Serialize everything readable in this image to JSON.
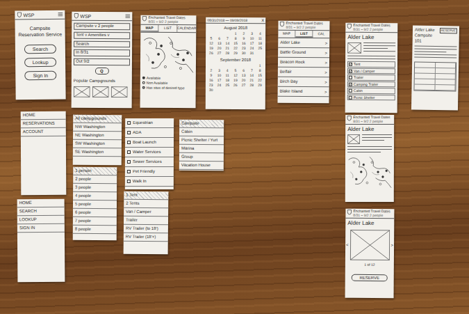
{
  "cards": [
    {
      "kind": "home",
      "header": "WSP",
      "lines": [
        "Campsite",
        "Reservation Service"
      ],
      "buttons": [
        "Search",
        "Lookup",
        "Sign In"
      ]
    },
    {
      "kind": "search",
      "header": "WSP",
      "fields": [
        "Campsite v  2 people",
        "Tent v  Amenities v",
        "Search",
        "In 8/31",
        "Out 9/2"
      ],
      "button": "Q",
      "section": "Popular Campgrounds"
    },
    {
      "kind": "map",
      "banner": {
        "title": "Enchanted Travel Dates",
        "sub": "8/31 – 9/2  2 people"
      },
      "tabs": [
        {
          "label": "MAP",
          "selected": true
        },
        {
          "label": "LIST",
          "selected": false
        },
        {
          "label": "CALENDAR",
          "selected": false
        }
      ],
      "legend": [
        "Available",
        "Non Available",
        "Has sites of desired type"
      ]
    },
    {
      "kind": "calendar",
      "range": "08/31/2018 — 09/09/2018",
      "close": "X",
      "months": [
        {
          "name": "August 2018",
          "days": [
            "1",
            "2",
            "3",
            "4",
            "5",
            "6",
            "7",
            "8",
            "9",
            "10",
            "11",
            "12",
            "13",
            "14",
            "15",
            "16",
            "17",
            "18",
            "19",
            "20",
            "21",
            "22",
            "23",
            "24",
            "25",
            "26",
            "27",
            "28",
            "29",
            "30",
            "31"
          ]
        },
        {
          "name": "September 2018",
          "days": [
            "1",
            "2",
            "3",
            "4",
            "5",
            "6",
            "7",
            "8",
            "9",
            "10",
            "11",
            "12",
            "13",
            "14",
            "15",
            "16",
            "17",
            "18",
            "19",
            "20",
            "21",
            "22",
            "23",
            "24",
            "25",
            "26",
            "27",
            "28",
            "29",
            "30"
          ]
        }
      ]
    },
    {
      "kind": "list",
      "banner": {
        "title": "Enchanted Travel Dates",
        "sub": "8/31 – 9/2  2 people"
      },
      "tabs": [
        {
          "label": "MAP",
          "selected": false
        },
        {
          "label": "LIST",
          "selected": true
        },
        {
          "label": "CAL",
          "selected": false
        }
      ],
      "arrow": ">",
      "items": [
        "Alder Lake",
        "Battle Ground",
        "Beacon Rock",
        "Belfair",
        "Birch Bay",
        "Blake Island"
      ]
    },
    {
      "kind": "detail",
      "banner": {
        "title": "Enchanted Travel Dates",
        "sub": "8/31 – 9/2  2 people"
      },
      "title": "Alder Lake",
      "options": [
        {
          "label": "Tent",
          "checked": true
        },
        {
          "label": "Van / Camper",
          "checked": true
        },
        {
          "label": "Trailer",
          "checked": false
        },
        {
          "label": "Camping Trailer",
          "checked": true
        },
        {
          "label": "Cabin",
          "checked": false
        },
        {
          "label": "Picnic Shelter",
          "checked": false
        }
      ]
    },
    {
      "kind": "site",
      "lines": [
        "Alder Lake",
        "Campsite 101"
      ],
      "button": "RESERVE"
    },
    {
      "kind": "menu",
      "items": [
        {
          "label": "HOME",
          "selected": false
        },
        {
          "label": "RESERVATIONS",
          "selected": false
        },
        {
          "label": "ACCOUNT",
          "selected": false
        }
      ]
    },
    {
      "kind": "menu",
      "items": [
        {
          "label": "All campgrounds",
          "selected": true
        },
        {
          "label": "NW Washington",
          "selected": false
        },
        {
          "label": "NE Washington",
          "selected": false
        },
        {
          "label": "SW Washington",
          "selected": false
        },
        {
          "label": "SE Washington",
          "selected": false
        }
      ]
    },
    {
      "kind": "checklist",
      "items": [
        {
          "label": "Equestrian",
          "checked": false
        },
        {
          "label": "ADA",
          "checked": false
        },
        {
          "label": "Boat Launch",
          "checked": false
        },
        {
          "label": "Water Services",
          "checked": false
        },
        {
          "label": "Sewer Services",
          "checked": false
        },
        {
          "label": "Pet Friendly",
          "checked": false
        },
        {
          "label": "Walk In",
          "checked": false
        }
      ]
    },
    {
      "kind": "menu",
      "items": [
        {
          "label": "Campsite",
          "selected": true
        },
        {
          "label": "Cabin",
          "selected": false
        },
        {
          "label": "Picnic Shelter / Yurt",
          "selected": false
        },
        {
          "label": "Marina",
          "selected": false
        },
        {
          "label": "Group",
          "selected": false
        },
        {
          "label": "Vacation House",
          "selected": false
        }
      ]
    },
    {
      "kind": "menu",
      "items": [
        {
          "label": "1 person",
          "selected": true
        },
        {
          "label": "2 people",
          "selected": false
        },
        {
          "label": "3 people",
          "selected": false
        },
        {
          "label": "4 people",
          "selected": false
        },
        {
          "label": "5 people",
          "selected": false
        },
        {
          "label": "6 people",
          "selected": false
        },
        {
          "label": "7 people",
          "selected": false
        },
        {
          "label": "8 people",
          "selected": false
        }
      ]
    },
    {
      "kind": "menu",
      "items": [
        {
          "label": "1 Tent",
          "selected": true
        },
        {
          "label": "2 Tents",
          "selected": false
        },
        {
          "label": "Van / Camper",
          "selected": false
        },
        {
          "label": "Trailer",
          "selected": false
        },
        {
          "label": "RV Trailer (to 18')",
          "selected": false
        },
        {
          "label": "RV Trailer (18'+)",
          "selected": false
        }
      ]
    },
    {
      "kind": "menu",
      "items": [
        {
          "label": "HOME",
          "selected": false
        },
        {
          "label": "SEARCH",
          "selected": false
        },
        {
          "label": "LOOKUP",
          "selected": false
        },
        {
          "label": "SIGN IN",
          "selected": false
        }
      ]
    },
    {
      "kind": "mapdetail",
      "banner": {
        "title": "Enchanted Travel Dates",
        "sub": "8/31 – 9/2  2 people"
      },
      "title": "Alder Lake"
    },
    {
      "kind": "gallery",
      "banner": {
        "title": "Enchanted Travel Dates",
        "sub": "8/31 – 9/2  2 people"
      },
      "title": "Alder Lake",
      "prev": "<",
      "next": ">",
      "counter": "1 of 12",
      "button": "RESERVE"
    }
  ]
}
